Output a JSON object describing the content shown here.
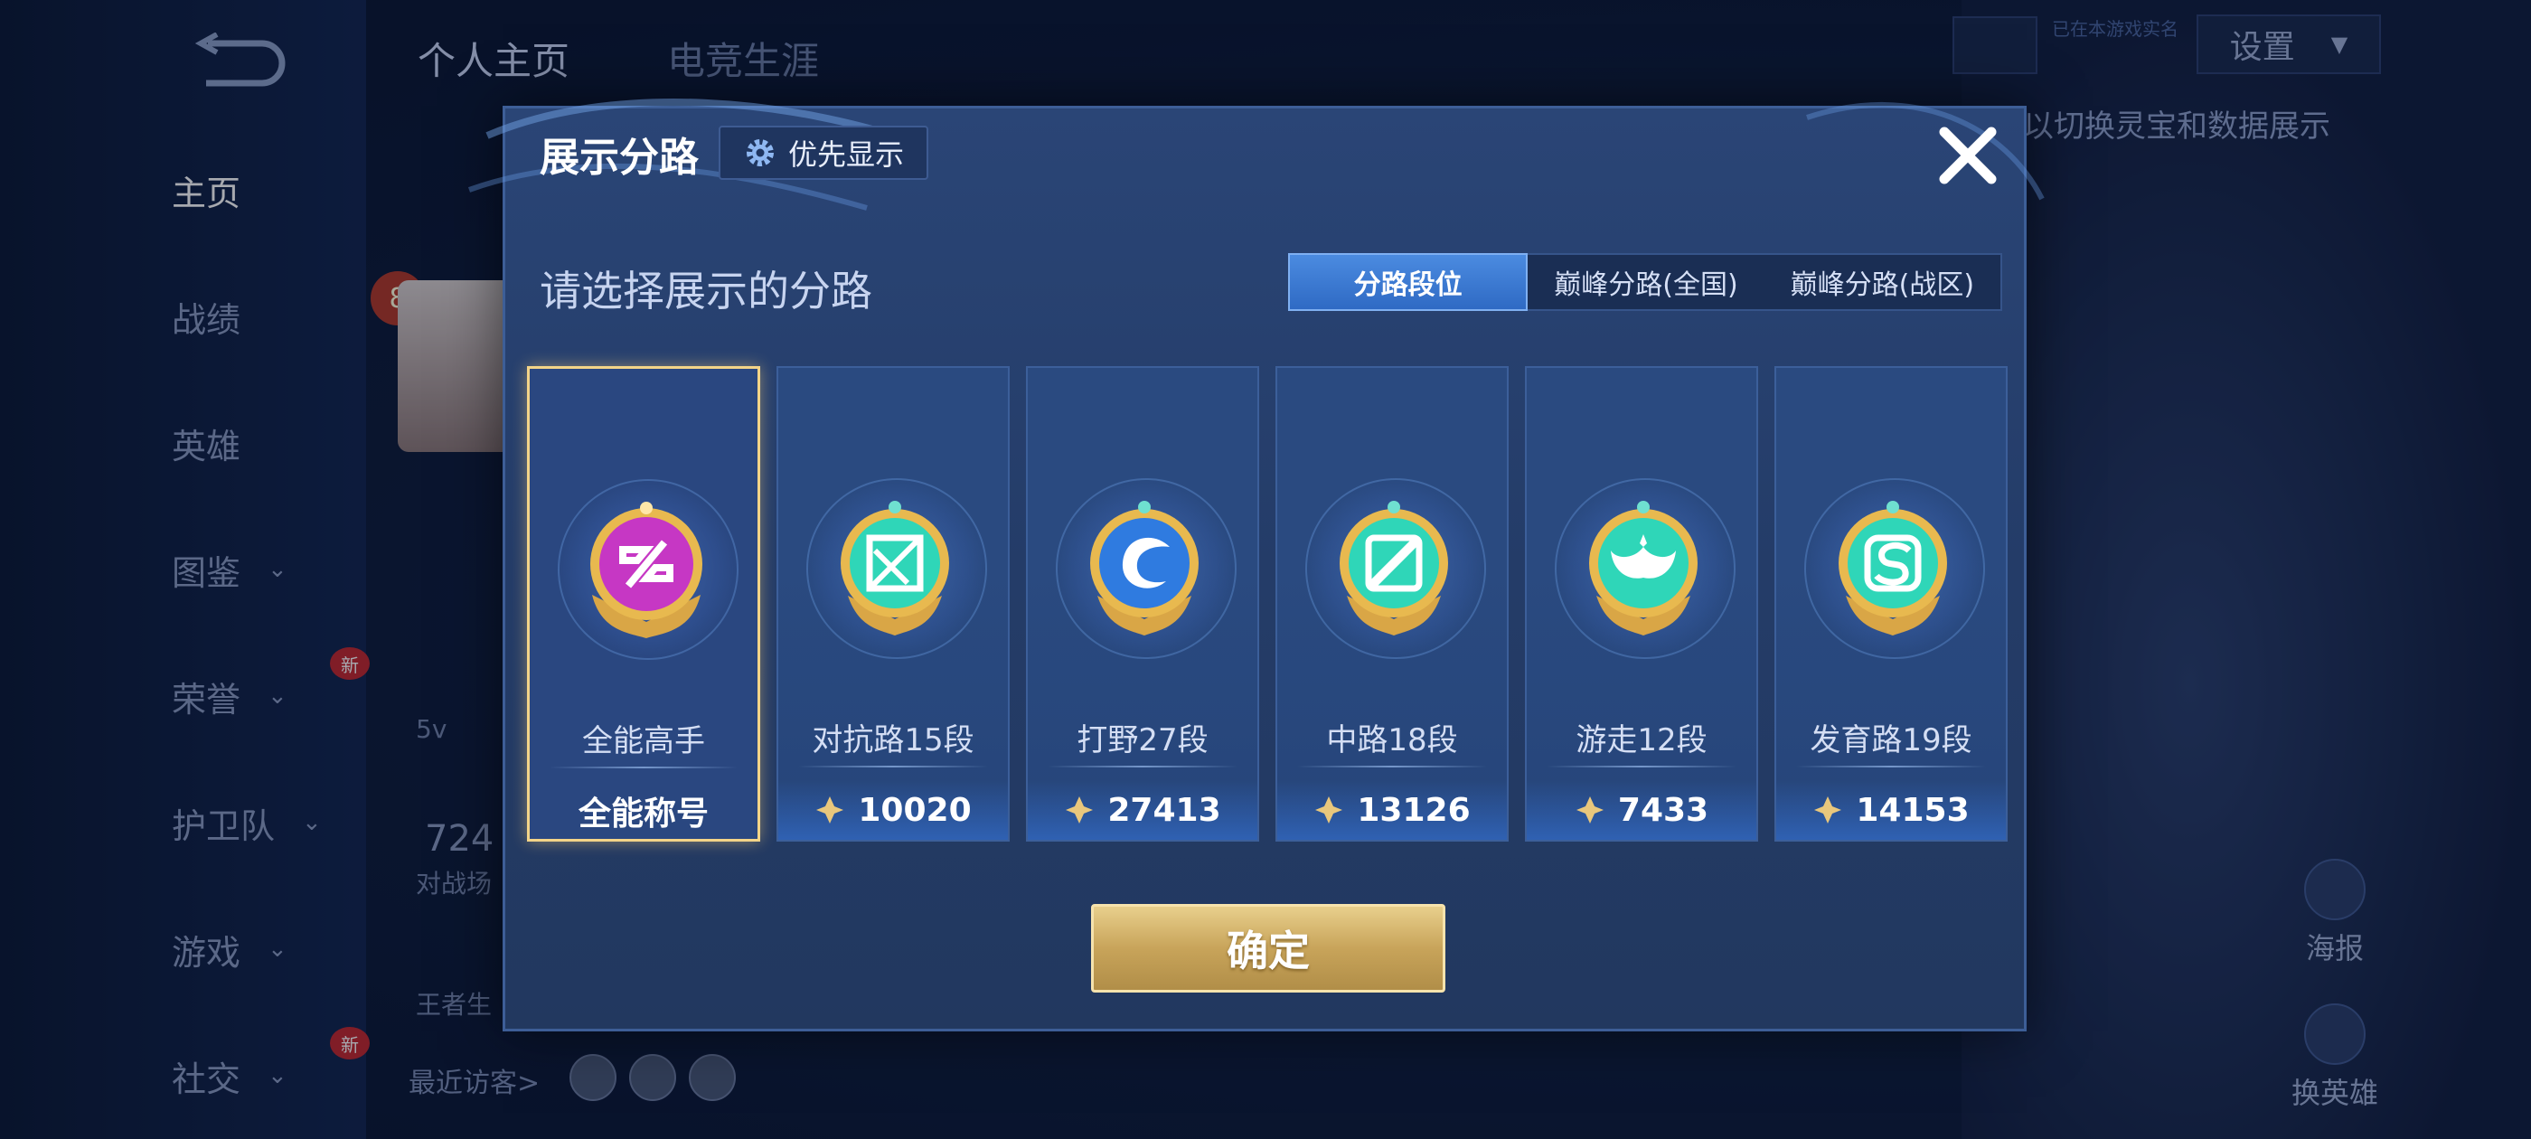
{
  "background": {
    "sidebar_items": [
      {
        "label": "主页",
        "active": true,
        "chevron": false,
        "new": false
      },
      {
        "label": "战绩",
        "active": false,
        "chevron": false,
        "new": false
      },
      {
        "label": "英雄",
        "active": false,
        "chevron": false,
        "new": false
      },
      {
        "label": "图鉴",
        "active": false,
        "chevron": true,
        "new": false
      },
      {
        "label": "荣誉",
        "active": false,
        "chevron": true,
        "new": true
      },
      {
        "label": "护卫队",
        "active": false,
        "chevron": true,
        "new": false
      },
      {
        "label": "游戏",
        "active": false,
        "chevron": true,
        "new": false
      },
      {
        "label": "社交",
        "active": false,
        "chevron": true,
        "new": true
      }
    ],
    "new_badge": "新",
    "top_tabs": [
      "个人主页",
      "电竞生涯"
    ],
    "settings_label": "设置",
    "small_tag": "已在本游戏实名",
    "hint_text": "以切换灵宝和数据展示",
    "rank_number": "8",
    "stat_partial": "724",
    "stat_label_partial": "对战场",
    "mode_partial": "5v",
    "bottom_left_partial": "王者生",
    "visitor_label": "最近访客>",
    "right_buttons": [
      "海报",
      "换英雄"
    ]
  },
  "modal": {
    "title": "展示分路",
    "priority_button": "优先显示",
    "subtitle": "请选择展示的分路",
    "tabs": [
      {
        "label": "分路段位",
        "active": true
      },
      {
        "label": "巅峰分路(全国)",
        "active": false
      },
      {
        "label": "巅峰分路(战区)",
        "active": false
      }
    ],
    "cards": [
      {
        "name": "全能高手",
        "bottom": "全能称号",
        "selected": true,
        "badge_icon": "purple-emblem-icon",
        "color": "#c637c4"
      },
      {
        "name": "对抗路15段",
        "score": "10020",
        "selected": false,
        "badge_icon": "clash-lane-icon",
        "color": "#2fd6b8"
      },
      {
        "name": "打野27段",
        "score": "27413",
        "selected": false,
        "badge_icon": "jungle-dragon-icon",
        "color": "#2f7be0"
      },
      {
        "name": "中路18段",
        "score": "13126",
        "selected": false,
        "badge_icon": "mid-lane-icon",
        "color": "#2fd6b8"
      },
      {
        "name": "游走12段",
        "score": "7433",
        "selected": false,
        "badge_icon": "roam-wings-icon",
        "color": "#2fd6b8"
      },
      {
        "name": "发育路19段",
        "score": "14153",
        "selected": false,
        "badge_icon": "farm-lane-icon",
        "color": "#2fd6b8"
      }
    ],
    "confirm": "确定",
    "colors": {
      "gold": "#e6c780",
      "accent_blue": "#3a78d6"
    }
  }
}
